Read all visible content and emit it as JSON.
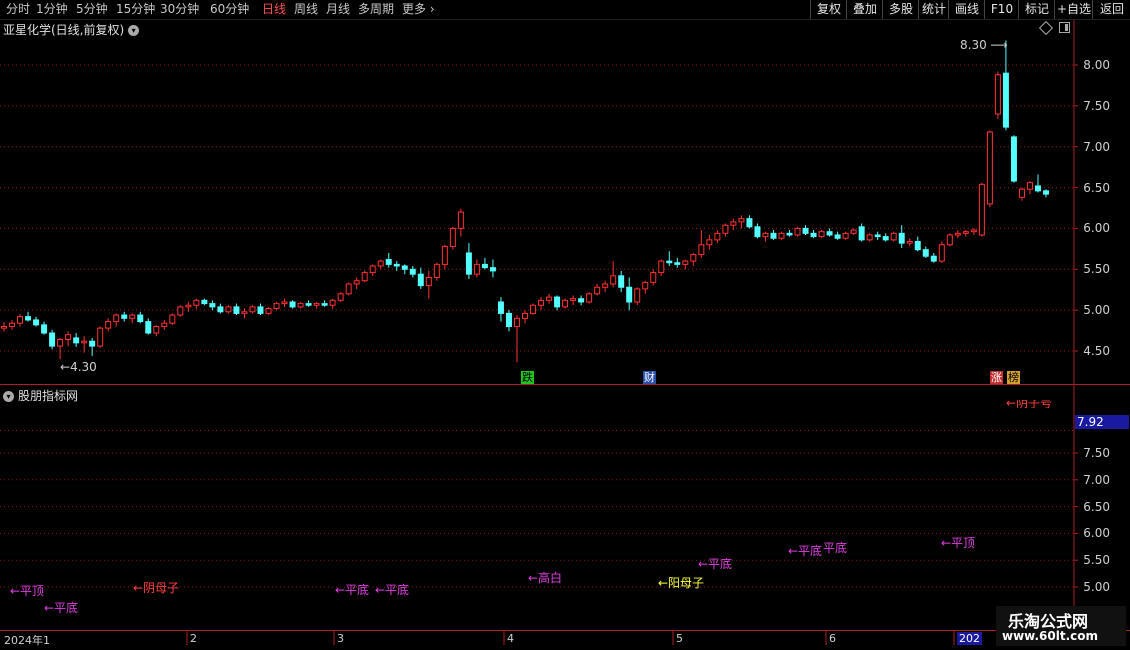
{
  "toolbar": {
    "periods": [
      "分时",
      "1分钟",
      "5分钟",
      "15分钟",
      "30分钟",
      "60分钟",
      "日线",
      "周线",
      "月线",
      "多周期",
      "更多"
    ],
    "active_period": "日线",
    "more_icon": "chevron-right-icon",
    "right_buttons": [
      "复权",
      "叠加",
      "多股",
      "统计",
      "画线",
      "F10",
      "标记",
      "+自选",
      "返回"
    ]
  },
  "chart": {
    "title": "亚星化学(日线,前复权)",
    "price_axis": [
      "8.00",
      "7.50",
      "7.00",
      "6.50",
      "6.00",
      "5.50",
      "5.00",
      "4.50"
    ],
    "high_label": "8.30",
    "low_label": "4.30",
    "event_badges": [
      {
        "text": "跌",
        "color": "#1ec81e"
      },
      {
        "text": "财",
        "color": "#3a6fd8"
      },
      {
        "text": "涨",
        "color": "#e04040"
      },
      {
        "text": "榜",
        "color": "#c89a2a"
      }
    ]
  },
  "indicator": {
    "title": "股朋指标网",
    "current_value": "7.92",
    "axis": [
      "7.50",
      "7.00",
      "6.50",
      "6.00",
      "5.50",
      "5.00"
    ],
    "annotations": [
      {
        "text": "←平顶",
        "color": "#e040e0"
      },
      {
        "text": "←平底",
        "color": "#e040e0"
      },
      {
        "text": "←阴母子",
        "color": "#ff4040"
      },
      {
        "text": "←平底",
        "color": "#e040e0"
      },
      {
        "text": "←平底",
        "color": "#e040e0"
      },
      {
        "text": "←高白",
        "color": "#e040e0"
      },
      {
        "text": "←阳母子",
        "color": "#ffff40"
      },
      {
        "text": "←平底",
        "color": "#e040e0"
      },
      {
        "text": "←平底",
        "color": "#e040e0"
      },
      {
        "text": "平底",
        "color": "#e040e0"
      },
      {
        "text": "←平顶",
        "color": "#e040e0"
      },
      {
        "text": "←阴子号",
        "color": "#ff4040"
      }
    ]
  },
  "x_axis": {
    "months": [
      "2024年1",
      "2",
      "3",
      "4",
      "5",
      "6",
      "202"
    ]
  },
  "watermark": {
    "line1": "乐淘公式网",
    "line2": "www.60lt.com"
  },
  "colors": {
    "up": "#ff3232",
    "down": "#54ffff",
    "grid": "#8b1a1a",
    "frame": "#b01e1e"
  },
  "chart_data": {
    "type": "candlestick",
    "title": "亚星化学(日线,前复权)",
    "ylim": [
      4.2,
      8.4
    ],
    "annotations": [
      "8.30",
      "4.30"
    ],
    "ohlc": [
      [
        4.78,
        4.85,
        4.74,
        4.8
      ],
      [
        4.8,
        4.88,
        4.76,
        4.84
      ],
      [
        4.84,
        4.95,
        4.8,
        4.92
      ],
      [
        4.92,
        4.98,
        4.86,
        4.88
      ],
      [
        4.88,
        4.92,
        4.8,
        4.82
      ],
      [
        4.82,
        4.86,
        4.7,
        4.72
      ],
      [
        4.72,
        4.76,
        4.52,
        4.56
      ],
      [
        4.56,
        4.66,
        4.4,
        4.64
      ],
      [
        4.64,
        4.74,
        4.56,
        4.7
      ],
      [
        4.66,
        4.72,
        4.55,
        4.6
      ],
      [
        4.6,
        4.68,
        4.48,
        4.62
      ],
      [
        4.62,
        4.66,
        4.44,
        4.56
      ],
      [
        4.56,
        4.8,
        4.54,
        4.78
      ],
      [
        4.78,
        4.9,
        4.74,
        4.86
      ],
      [
        4.86,
        4.96,
        4.8,
        4.94
      ],
      [
        4.94,
        4.98,
        4.86,
        4.9
      ],
      [
        4.9,
        4.96,
        4.84,
        4.94
      ],
      [
        4.94,
        4.98,
        4.84,
        4.86
      ],
      [
        4.86,
        4.9,
        4.7,
        4.72
      ],
      [
        4.72,
        4.82,
        4.68,
        4.8
      ],
      [
        4.8,
        4.88,
        4.76,
        4.84
      ],
      [
        4.84,
        4.96,
        4.82,
        4.94
      ],
      [
        4.94,
        5.06,
        4.92,
        5.04
      ],
      [
        5.04,
        5.1,
        4.98,
        5.06
      ],
      [
        5.06,
        5.14,
        5.02,
        5.12
      ],
      [
        5.12,
        5.14,
        5.06,
        5.08
      ],
      [
        5.08,
        5.12,
        5.0,
        5.04
      ],
      [
        5.04,
        5.08,
        4.96,
        4.98
      ],
      [
        4.98,
        5.06,
        4.96,
        5.04
      ],
      [
        5.04,
        5.08,
        4.94,
        4.96
      ],
      [
        4.96,
        5.02,
        4.9,
        4.98
      ],
      [
        4.98,
        5.06,
        4.96,
        5.04
      ],
      [
        5.04,
        5.08,
        4.94,
        4.96
      ],
      [
        4.96,
        5.04,
        4.94,
        5.02
      ],
      [
        5.02,
        5.1,
        5.0,
        5.08
      ],
      [
        5.08,
        5.14,
        5.04,
        5.1
      ],
      [
        5.1,
        5.12,
        5.02,
        5.04
      ],
      [
        5.04,
        5.1,
        5.02,
        5.08
      ],
      [
        5.08,
        5.12,
        5.04,
        5.06
      ],
      [
        5.06,
        5.1,
        5.02,
        5.08
      ],
      [
        5.08,
        5.12,
        5.04,
        5.06
      ],
      [
        5.06,
        5.14,
        5.02,
        5.12
      ],
      [
        5.12,
        5.22,
        5.1,
        5.2
      ],
      [
        5.2,
        5.34,
        5.18,
        5.32
      ],
      [
        5.32,
        5.4,
        5.26,
        5.36
      ],
      [
        5.36,
        5.48,
        5.34,
        5.46
      ],
      [
        5.46,
        5.56,
        5.42,
        5.54
      ],
      [
        5.54,
        5.62,
        5.5,
        5.6
      ],
      [
        5.62,
        5.7,
        5.52,
        5.56
      ],
      [
        5.56,
        5.6,
        5.48,
        5.54
      ],
      [
        5.54,
        5.56,
        5.44,
        5.5
      ],
      [
        5.5,
        5.54,
        5.4,
        5.44
      ],
      [
        5.44,
        5.52,
        5.26,
        5.3
      ],
      [
        5.3,
        5.48,
        5.14,
        5.4
      ],
      [
        5.4,
        5.58,
        5.36,
        5.56
      ],
      [
        5.56,
        5.8,
        5.5,
        5.78
      ],
      [
        5.78,
        6.02,
        5.74,
        6.0
      ],
      [
        6.0,
        6.24,
        5.9,
        6.2
      ],
      [
        5.7,
        5.82,
        5.38,
        5.44
      ],
      [
        5.44,
        5.62,
        5.4,
        5.56
      ],
      [
        5.56,
        5.64,
        5.5,
        5.52
      ],
      [
        5.52,
        5.62,
        5.4,
        5.48
      ],
      [
        5.1,
        5.16,
        4.86,
        4.96
      ],
      [
        4.96,
        5.0,
        4.74,
        4.8
      ],
      [
        4.8,
        4.94,
        4.36,
        4.9
      ],
      [
        4.9,
        5.0,
        4.84,
        4.96
      ],
      [
        4.96,
        5.08,
        4.94,
        5.06
      ],
      [
        5.06,
        5.16,
        5.0,
        5.12
      ],
      [
        5.12,
        5.2,
        5.08,
        5.16
      ],
      [
        5.16,
        5.18,
        5.0,
        5.04
      ],
      [
        5.04,
        5.14,
        5.02,
        5.12
      ],
      [
        5.12,
        5.18,
        5.06,
        5.14
      ],
      [
        5.14,
        5.18,
        5.06,
        5.1
      ],
      [
        5.1,
        5.22,
        5.08,
        5.2
      ],
      [
        5.2,
        5.32,
        5.18,
        5.28
      ],
      [
        5.28,
        5.36,
        5.22,
        5.32
      ],
      [
        5.32,
        5.6,
        5.28,
        5.42
      ],
      [
        5.42,
        5.48,
        5.22,
        5.28
      ],
      [
        5.28,
        5.4,
        5.0,
        5.1
      ],
      [
        5.1,
        5.28,
        5.06,
        5.26
      ],
      [
        5.26,
        5.36,
        5.2,
        5.34
      ],
      [
        5.34,
        5.5,
        5.3,
        5.46
      ],
      [
        5.46,
        5.62,
        5.42,
        5.6
      ],
      [
        5.6,
        5.72,
        5.54,
        5.58
      ],
      [
        5.58,
        5.64,
        5.52,
        5.56
      ],
      [
        5.56,
        5.62,
        5.5,
        5.6
      ],
      [
        5.6,
        5.7,
        5.54,
        5.68
      ],
      [
        5.68,
        5.98,
        5.64,
        5.8
      ],
      [
        5.8,
        5.92,
        5.74,
        5.86
      ],
      [
        5.86,
        5.98,
        5.82,
        5.94
      ],
      [
        5.94,
        6.06,
        5.9,
        6.04
      ],
      [
        6.04,
        6.12,
        5.98,
        6.08
      ],
      [
        6.08,
        6.16,
        6.0,
        6.12
      ],
      [
        6.12,
        6.16,
        6.0,
        6.02
      ],
      [
        6.02,
        6.06,
        5.88,
        5.9
      ],
      [
        5.9,
        5.96,
        5.84,
        5.94
      ],
      [
        5.94,
        5.98,
        5.86,
        5.88
      ],
      [
        5.88,
        5.96,
        5.86,
        5.94
      ],
      [
        5.94,
        5.98,
        5.9,
        5.92
      ],
      [
        5.92,
        6.02,
        5.9,
        6.0
      ],
      [
        6.0,
        6.04,
        5.92,
        5.94
      ],
      [
        5.94,
        5.98,
        5.88,
        5.9
      ],
      [
        5.9,
        5.98,
        5.88,
        5.96
      ],
      [
        5.96,
        6.0,
        5.9,
        5.92
      ],
      [
        5.92,
        5.96,
        5.86,
        5.88
      ],
      [
        5.88,
        5.96,
        5.86,
        5.94
      ],
      [
        5.94,
        6.0,
        5.92,
        5.98
      ],
      [
        6.02,
        6.06,
        5.84,
        5.86
      ],
      [
        5.86,
        5.94,
        5.84,
        5.92
      ],
      [
        5.92,
        5.96,
        5.86,
        5.9
      ],
      [
        5.9,
        5.94,
        5.84,
        5.86
      ],
      [
        5.86,
        5.96,
        5.84,
        5.94
      ],
      [
        5.94,
        6.04,
        5.76,
        5.82
      ],
      [
        5.82,
        5.88,
        5.78,
        5.84
      ],
      [
        5.84,
        5.9,
        5.72,
        5.74
      ],
      [
        5.74,
        5.78,
        5.64,
        5.66
      ],
      [
        5.66,
        5.7,
        5.58,
        5.6
      ],
      [
        5.6,
        5.84,
        5.58,
        5.8
      ],
      [
        5.8,
        5.94,
        5.78,
        5.92
      ],
      [
        5.92,
        5.98,
        5.88,
        5.94
      ],
      [
        5.94,
        5.98,
        5.9,
        5.96
      ],
      [
        5.96,
        6.0,
        5.92,
        5.98
      ],
      [
        5.92,
        6.56,
        5.9,
        6.54
      ],
      [
        6.3,
        7.2,
        6.26,
        7.18
      ],
      [
        7.4,
        7.92,
        7.34,
        7.88
      ],
      [
        7.9,
        8.3,
        7.2,
        7.24
      ],
      [
        7.12,
        7.14,
        6.56,
        6.58
      ],
      [
        6.38,
        6.5,
        6.34,
        6.48
      ],
      [
        6.48,
        6.58,
        6.42,
        6.56
      ],
      [
        6.52,
        6.66,
        6.44,
        6.46
      ],
      [
        6.46,
        6.48,
        6.38,
        6.42
      ]
    ]
  }
}
